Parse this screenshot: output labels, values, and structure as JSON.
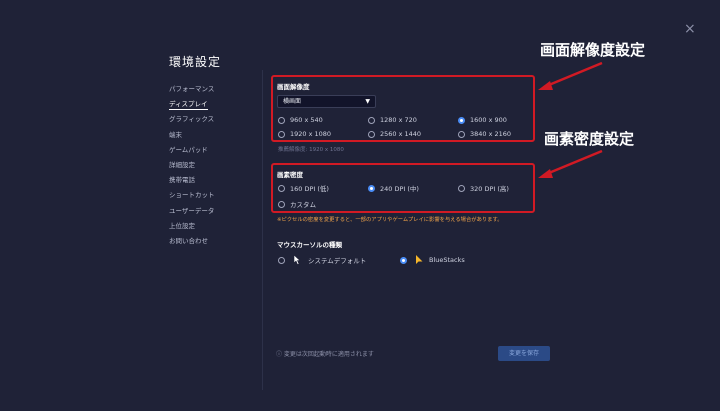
{
  "settings": {
    "title": "環境設定",
    "close_glyph": "×"
  },
  "nav": {
    "items": [
      {
        "label": "パフォーマンス",
        "active": false
      },
      {
        "label": "ディスプレイ",
        "active": true
      },
      {
        "label": "グラフィックス",
        "active": false
      },
      {
        "label": "端末",
        "active": false
      },
      {
        "label": "ゲームパッド",
        "active": false
      },
      {
        "label": "詳細設定",
        "active": false
      },
      {
        "label": "携帯電話",
        "active": false
      },
      {
        "label": "ショートカット",
        "active": false
      },
      {
        "label": "ユーザーデータ",
        "active": false
      },
      {
        "label": "上位設定",
        "active": false
      },
      {
        "label": "お問い合わせ",
        "active": false
      }
    ]
  },
  "resolution": {
    "label": "画面解像度",
    "orientation_value": "横画面",
    "options": [
      {
        "label": "960 x 540",
        "selected": false
      },
      {
        "label": "1280 x 720",
        "selected": false
      },
      {
        "label": "1600 x 900",
        "selected": true
      },
      {
        "label": "1920 x 1080",
        "selected": false
      },
      {
        "label": "2560 x 1440",
        "selected": false
      },
      {
        "label": "3840 x 2160",
        "selected": false
      }
    ],
    "recommended": "推薦解像度: 1920 x 1080"
  },
  "density": {
    "label": "画素密度",
    "options": [
      {
        "label": "160 DPI (低)",
        "selected": false
      },
      {
        "label": "240 DPI (中)",
        "selected": true
      },
      {
        "label": "320 DPI (高)",
        "selected": false
      },
      {
        "label": "カスタム",
        "selected": false
      }
    ],
    "warning": "※ピクセルの密度を変更すると、一部のアプリやゲームプレイに影響を与える場合があります。"
  },
  "cursor": {
    "label": "マウスカーソルの種類",
    "options": [
      {
        "label": "システムデフォルト",
        "selected": false
      },
      {
        "label": "BlueStacks",
        "selected": true
      }
    ]
  },
  "annotations": {
    "resolution_setting": "画面解像度設定",
    "density_setting": "画素密度設定"
  },
  "footer": {
    "note": "ⓘ 変更は次回起動時に適用されます",
    "save_label": "変更を保存"
  },
  "colors": {
    "background": "#1f2237",
    "accent": "#4a8df6",
    "highlight_box": "#d11a24",
    "warning": "#f0a34a"
  },
  "icons": [
    "close-icon",
    "dropdown-caret-icon",
    "arrow-cursor-icon",
    "bluestacks-cursor-icon",
    "red-arrow-icon",
    "info-icon"
  ]
}
